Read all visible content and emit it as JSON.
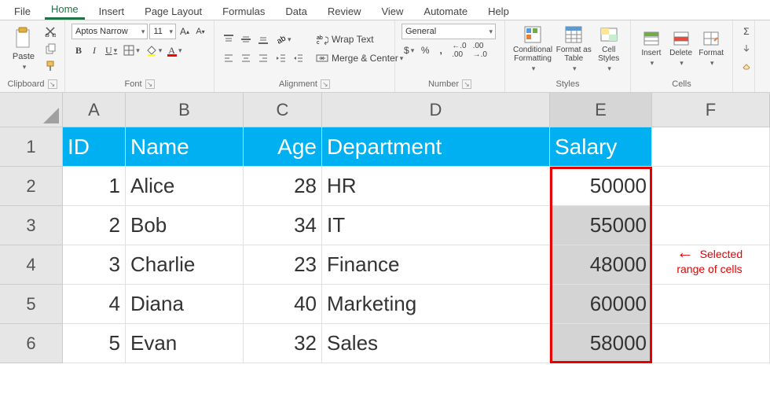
{
  "tabs": {
    "file": "File",
    "home": "Home",
    "insert": "Insert",
    "page_layout": "Page Layout",
    "formulas": "Formulas",
    "data": "Data",
    "review": "Review",
    "view": "View",
    "automate": "Automate",
    "help": "Help"
  },
  "ribbon": {
    "clipboard": {
      "paste": "Paste",
      "label": "Clipboard"
    },
    "font": {
      "name": "Aptos Narrow",
      "size": "11",
      "label": "Font",
      "bold": "B",
      "italic": "I",
      "underline": "U"
    },
    "alignment": {
      "label": "Alignment",
      "wrap": "Wrap Text",
      "merge": "Merge & Center"
    },
    "number": {
      "label": "Number",
      "format": "General",
      "currency": "$",
      "percent": "%",
      "comma": ","
    },
    "styles": {
      "label": "Styles",
      "cond": "Conditional Formatting",
      "table": "Format as Table",
      "cellstyles": "Cell Styles"
    },
    "cells": {
      "label": "Cells",
      "insert": "Insert",
      "delete": "Delete",
      "format": "Format"
    }
  },
  "columns": [
    "A",
    "B",
    "C",
    "D",
    "E",
    "F"
  ],
  "rows": [
    "1",
    "2",
    "3",
    "4",
    "5",
    "6"
  ],
  "headers": {
    "id": "ID",
    "name": "Name",
    "age": "Age",
    "dept": "Department",
    "salary": "Salary"
  },
  "data": [
    {
      "id": "1",
      "name": "Alice",
      "age": "28",
      "dept": "HR",
      "salary": "50000"
    },
    {
      "id": "2",
      "name": "Bob",
      "age": "34",
      "dept": "IT",
      "salary": "55000"
    },
    {
      "id": "3",
      "name": "Charlie",
      "age": "23",
      "dept": "Finance",
      "salary": "48000"
    },
    {
      "id": "4",
      "name": "Diana",
      "age": "40",
      "dept": "Marketing",
      "salary": "60000"
    },
    {
      "id": "5",
      "name": "Evan",
      "age": "32",
      "dept": "Sales",
      "salary": "58000"
    }
  ],
  "annotation": {
    "arrow": "←",
    "line1": "Selected",
    "line2": "range of cells"
  }
}
